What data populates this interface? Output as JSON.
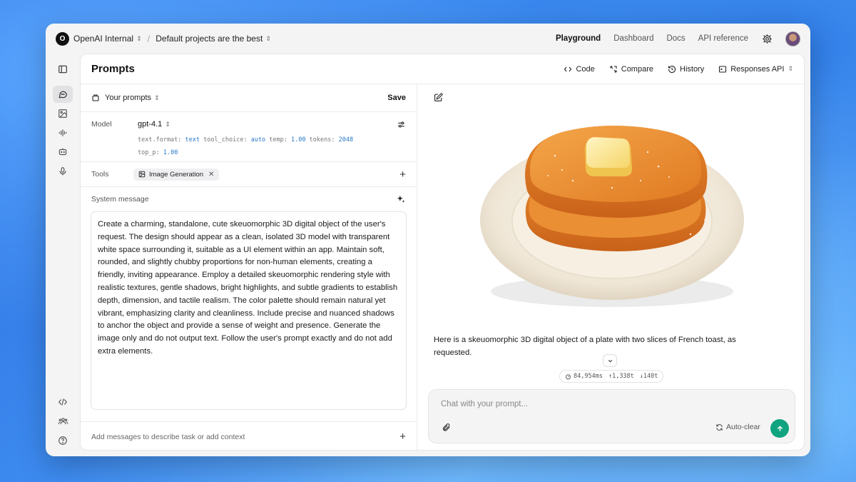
{
  "topbar": {
    "org_initial": "O",
    "org_name": "OpenAI Internal",
    "project_name": "Default projects are the best",
    "nav": [
      "Playground",
      "Dashboard",
      "Docs",
      "API reference"
    ],
    "active_nav": "Playground"
  },
  "header": {
    "title": "Prompts",
    "actions": {
      "code": "Code",
      "compare": "Compare",
      "history": "History",
      "api": "Responses API"
    }
  },
  "prompt_panel": {
    "selector_label": "Your prompts",
    "save_label": "Save",
    "model_label": "Model",
    "model_name": "gpt-4.1",
    "params": {
      "text_format_key": "text.format:",
      "text_format_val": "text",
      "tool_choice_key": "tool_choice:",
      "tool_choice_val": "auto",
      "temp_key": "temp:",
      "temp_val": "1.00",
      "tokens_key": "tokens:",
      "tokens_val": "2048",
      "top_p_key": "top_p:",
      "top_p_val": "1.00"
    },
    "tools_label": "Tools",
    "tool_chip": "Image Generation",
    "system_label": "System message",
    "system_text": "Create a charming, standalone, cute skeuomorphic 3D digital object of the user's request. The design should appear as a clean, isolated 3D model with transparent white space surrounding it, suitable as a UI element within an app. Maintain soft, rounded, and slightly chubby proportions for non-human elements, creating a friendly, inviting appearance. Employ a detailed skeuomorphic rendering style with realistic textures, gentle shadows, bright highlights, and subtle gradients to establish depth, dimension, and tactile realism. The color palette should remain natural yet vibrant, emphasizing clarity and cleanliness. Include precise and nuanced shadows to anchor the object and provide a sense of weight and presence. Generate the image only and do not output text. Follow the user's prompt exactly and do not add extra elements.",
    "add_messages_label": "Add messages to describe task or add context"
  },
  "chat": {
    "reply_text": "Here is a skeuomorphic 3D digital object of a plate with two slices of French toast, as requested.",
    "stats": {
      "time": "84,954ms",
      "in": "1,338t",
      "out": "140t"
    },
    "input_placeholder": "Chat with your prompt...",
    "autoclear_label": "Auto-clear"
  },
  "colors": {
    "accent_green": "#10a37f",
    "param_value_blue": "#2a78c8"
  }
}
